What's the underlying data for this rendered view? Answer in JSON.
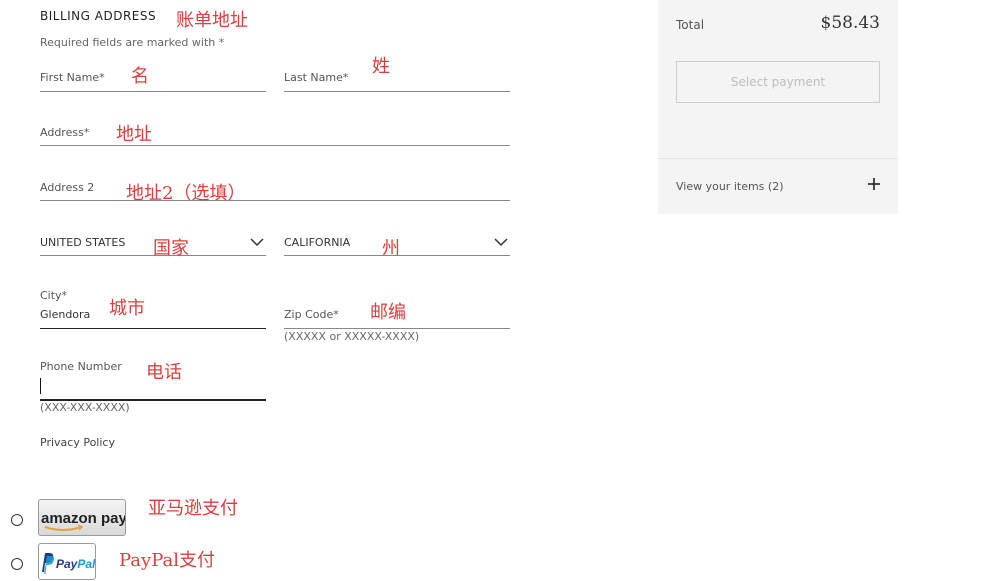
{
  "billing": {
    "title": "BILLING ADDRESS",
    "required_note": "Required fields are marked with *"
  },
  "fields": {
    "first_name": {
      "label": "First Name*"
    },
    "last_name": {
      "label": "Last Name*"
    },
    "address": {
      "label": "Address*"
    },
    "address2": {
      "label": "Address 2"
    },
    "country": {
      "value": "UNITED STATES"
    },
    "state": {
      "value": "CALIFORNIA"
    },
    "city": {
      "label": "City*",
      "value": "Glendora"
    },
    "zip": {
      "label": "Zip Code*",
      "helper": "(XXXXX or XXXXX-XXXX)"
    },
    "phone": {
      "label": "Phone Number",
      "helper": "(XXX-XXX-XXXX)"
    }
  },
  "privacy_policy": "Privacy Policy",
  "payment_methods": {
    "amazon": {
      "label": "amazon pay"
    },
    "paypal": {
      "label_pay": "Pay",
      "label_pal": "Pal"
    }
  },
  "annotations": {
    "billing_address": "账单地址",
    "first_name": "名",
    "last_name": "姓",
    "address": "地址",
    "address2": "地址2（选填）",
    "country": "国家",
    "state": "州",
    "city": "城市",
    "zip": "邮编",
    "phone": "电话",
    "amazon_pay": "亚马逊支付",
    "paypal": "PayPal支付"
  },
  "summary": {
    "total_label": "Total",
    "total_value": "$58.43",
    "select_payment": "Select payment",
    "view_items": "View your items (2)"
  },
  "colors": {
    "annotation": "#e03c3c",
    "panel_bg": "#f4f4f4",
    "paypal_dark": "#253b80",
    "paypal_light": "#179bd7"
  }
}
